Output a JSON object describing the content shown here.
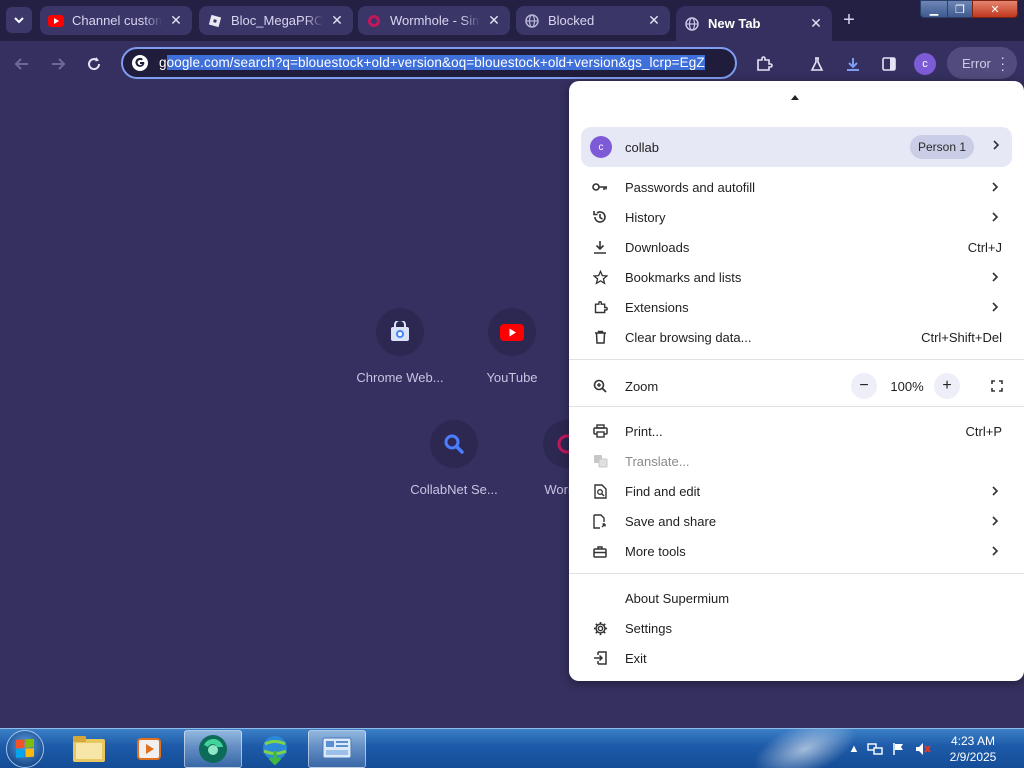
{
  "tabs": [
    {
      "title": "Channel customization - YouTube Studio",
      "favicon": "youtube-icon",
      "active": false
    },
    {
      "title": "Bloc_MegaPROXY",
      "favicon": "roblox-icon",
      "active": false
    },
    {
      "title": "Wormhole - Simple, private file sharing",
      "favicon": "wormhole-icon",
      "active": false
    },
    {
      "title": "Blocked",
      "favicon": "globe-icon",
      "active": false
    },
    {
      "title": "New Tab",
      "favicon": "globe-icon",
      "active": true
    }
  ],
  "omnibox": {
    "prefix": "g",
    "url_selected": "oogle.com/search?q=blouestock+old+version&oq=blouestock+old+version&gs_lcrp=EgZ"
  },
  "toolbar": {
    "avatar_initial": "c",
    "error_label": "Error"
  },
  "shortcuts": [
    {
      "label": "Chrome Web...",
      "icon": "chrome-web-store-icon"
    },
    {
      "label": "YouTube",
      "icon": "youtube-icon"
    },
    {
      "label": "CollabNet Se...",
      "icon": "search-icon"
    },
    {
      "label": "Worm...",
      "icon": "wormhole-icon"
    }
  ],
  "menu": {
    "profile": {
      "initial": "c",
      "name": "collab",
      "badge": "Person 1"
    },
    "items_group1": [
      {
        "label": "Passwords and autofill",
        "icon": "key-icon",
        "shortcut": "",
        "submenu": true
      },
      {
        "label": "History",
        "icon": "history-icon",
        "shortcut": "",
        "submenu": true
      },
      {
        "label": "Downloads",
        "icon": "download-icon",
        "shortcut": "Ctrl+J",
        "submenu": false
      },
      {
        "label": "Bookmarks and lists",
        "icon": "star-icon",
        "shortcut": "",
        "submenu": true
      },
      {
        "label": "Extensions",
        "icon": "puzzle-icon",
        "shortcut": "",
        "submenu": true
      },
      {
        "label": "Clear browsing data...",
        "icon": "trash-icon",
        "shortcut": "Ctrl+Shift+Del",
        "submenu": false
      }
    ],
    "zoom": {
      "label": "Zoom",
      "value": "100%"
    },
    "items_group2": [
      {
        "label": "Print...",
        "icon": "print-icon",
        "shortcut": "Ctrl+P",
        "submenu": false,
        "disabled": false
      },
      {
        "label": "Translate...",
        "icon": "translate-icon",
        "shortcut": "",
        "submenu": false,
        "disabled": true
      },
      {
        "label": "Find and edit",
        "icon": "find-icon",
        "shortcut": "",
        "submenu": true,
        "disabled": false
      },
      {
        "label": "Save and share",
        "icon": "save-share-icon",
        "shortcut": "",
        "submenu": true,
        "disabled": false
      },
      {
        "label": "More tools",
        "icon": "toolbox-icon",
        "shortcut": "",
        "submenu": true,
        "disabled": false
      }
    ],
    "items_group3": [
      {
        "label": "About Supermium",
        "icon": ""
      },
      {
        "label": "Settings",
        "icon": "gear-icon"
      },
      {
        "label": "Exit",
        "icon": "exit-icon"
      }
    ]
  },
  "taskbar": {
    "time": "4:23 AM",
    "date": "2/9/2025"
  },
  "colors": {
    "page_bg": "#35305f",
    "tabstrip_bg": "#232044",
    "accent_blue": "#7e9cf0",
    "avatar_purple": "#7d5bd6"
  }
}
